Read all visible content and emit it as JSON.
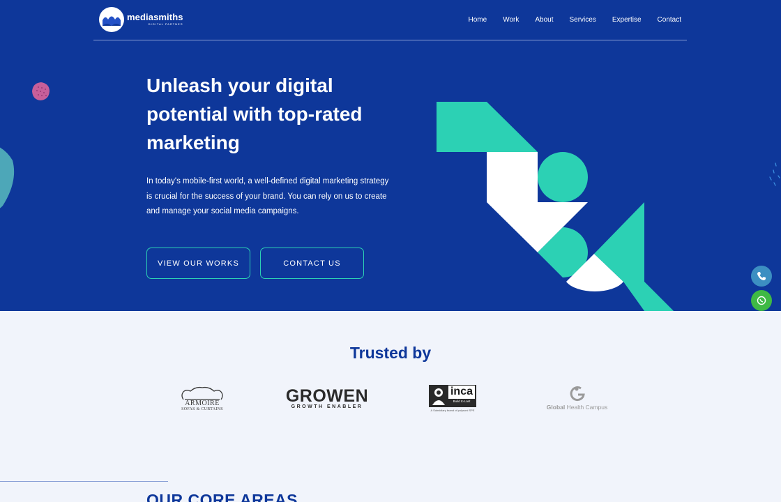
{
  "brand": {
    "name": "mediasmiths",
    "tagline": "DIGITAL PARTNER"
  },
  "nav": {
    "items": [
      "Home",
      "Work",
      "About",
      "Services",
      "Expertise",
      "Contact"
    ]
  },
  "hero": {
    "title": "Unleash your digital potential with top-rated marketing",
    "description": "In today's mobile-first world, a well-defined digital marketing strategy is crucial for the success of your brand. You can rely on us to create and manage your social media campaigns.",
    "buttons": {
      "works": "VIEW OUR WORKS",
      "contact": "CONTACT US"
    }
  },
  "trusted": {
    "title": "Trusted by",
    "clients": {
      "armoire": {
        "name": "ARMOIRE",
        "sub": "SOFAS & CURTAINS"
      },
      "growen": {
        "name": "GROWEN",
        "sub": "GROWTH ENABLER"
      },
      "inca": {
        "name": "inca",
        "build": "Build to Last",
        "sub": "A Subsidiary brand of polysoni SPE"
      },
      "ghc": {
        "name_bold": "Global",
        "name_rest": " Health Campus"
      }
    }
  },
  "core": {
    "title": "OUR CORE AREAS"
  },
  "floating": {
    "phone_icon": "phone-icon",
    "whatsapp_icon": "whatsapp-icon"
  },
  "colors": {
    "hero_bg": "#0e379a",
    "accent_teal": "#2cd1b4",
    "page_bg": "#f1f4fb",
    "phone": "#3c8fc2",
    "whatsapp": "#3fb944"
  }
}
